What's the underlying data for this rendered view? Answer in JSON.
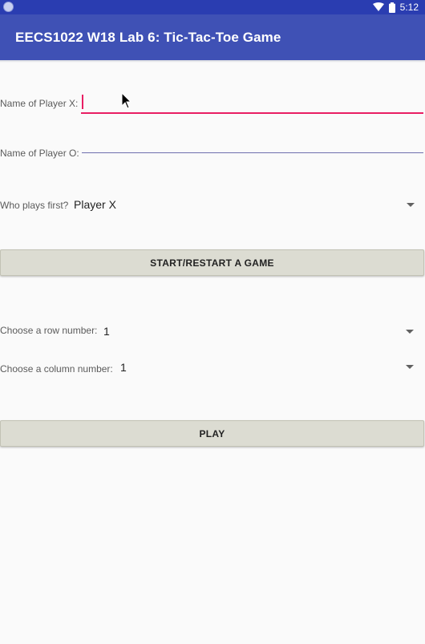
{
  "status_bar": {
    "time": "5:12"
  },
  "toolbar": {
    "title": "EECS1022 W18 Lab 6: Tic-Tac-Toe Game"
  },
  "form": {
    "player_x_label": "Name of Player X:",
    "player_x_value": "",
    "player_o_label": "Name of Player O:",
    "player_o_value": "",
    "first_label": "Who plays first?",
    "first_value": "Player X",
    "start_button": "START/RESTART A GAME",
    "row_label": "Choose a row number:",
    "row_value": "1",
    "col_label": "Choose a column number:",
    "col_value": "1",
    "play_button": "PLAY"
  },
  "icons": [
    "notification-dot-icon",
    "wifi-icon",
    "battery-icon",
    "dropdown-caret-icon",
    "mouse-pointer-icon"
  ],
  "colors": {
    "toolbar": "#3f51b5",
    "status_bar": "#2a3db1",
    "accent": "#e91e63",
    "button": "#dcdcd2"
  }
}
